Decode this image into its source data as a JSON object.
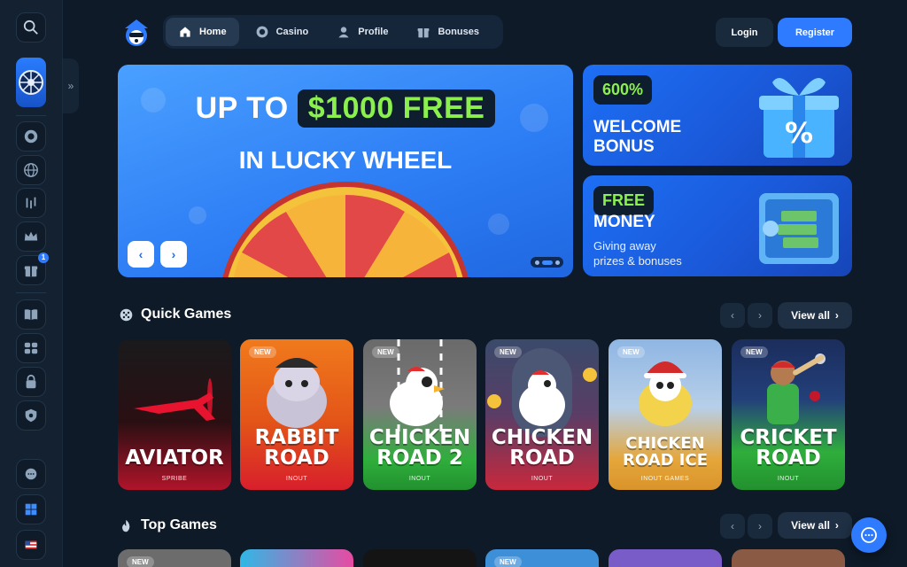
{
  "nav": {
    "items": [
      {
        "label": "Home",
        "icon": "home-icon",
        "active": true
      },
      {
        "label": "Casino",
        "icon": "chip-icon",
        "active": false
      },
      {
        "label": "Profile",
        "icon": "user-icon",
        "active": false
      },
      {
        "label": "Bonuses",
        "icon": "gift-icon",
        "active": false
      }
    ]
  },
  "auth": {
    "login": "Login",
    "register": "Register"
  },
  "sidebar": {
    "badge_count": "1",
    "icons": [
      "search-icon",
      "chip-icon",
      "globe-icon",
      "sports-icon",
      "crown-icon",
      "gift-icon",
      "book-icon",
      "gamepad-icon",
      "lock-icon",
      "shield-icon",
      "support-icon",
      "windows-icon",
      "flag-icon"
    ]
  },
  "hero": {
    "line1_a": "UP TO",
    "line1_b": "$1000 FREE",
    "line2": "IN LUCKY WHEEL",
    "prev": "‹",
    "next": "›"
  },
  "promos": [
    {
      "tag": "600%",
      "title_1": "WELCOME",
      "title_2": "BONUS"
    },
    {
      "tag": "FREE",
      "title_1": "MONEY",
      "desc_1": "Giving away",
      "desc_2": "prizes & bonuses"
    }
  ],
  "sections": {
    "quick_games": {
      "title": "Quick Games",
      "view_all": "View all"
    },
    "top_games": {
      "title": "Top Games",
      "view_all": "View all"
    }
  },
  "games": [
    {
      "name_1": "AVIATOR",
      "name_2": "",
      "provider": "SPRIBE",
      "is_new": false,
      "new_label": ""
    },
    {
      "name_1": "RABBIT",
      "name_2": "ROAD",
      "provider": "INOUT",
      "is_new": true,
      "new_label": "NEW"
    },
    {
      "name_1": "CHICKEN",
      "name_2": "ROAD 2",
      "provider": "INOUT",
      "is_new": true,
      "new_label": "NEW"
    },
    {
      "name_1": "CHICKEN",
      "name_2": "ROAD",
      "provider": "INOUT",
      "is_new": true,
      "new_label": "NEW"
    },
    {
      "name_1": "CHICKEN",
      "name_2": "ROAD ICE",
      "provider": "INOUT GAMES",
      "is_new": true,
      "new_label": "NEW"
    },
    {
      "name_1": "CRICKET",
      "name_2": "ROAD",
      "provider": "INOUT",
      "is_new": true,
      "new_label": "NEW"
    }
  ],
  "top_games_new_label": "NEW",
  "colors": {
    "accent": "#2f7bff",
    "green": "#8bf04e",
    "bg": "#0e1a28"
  }
}
